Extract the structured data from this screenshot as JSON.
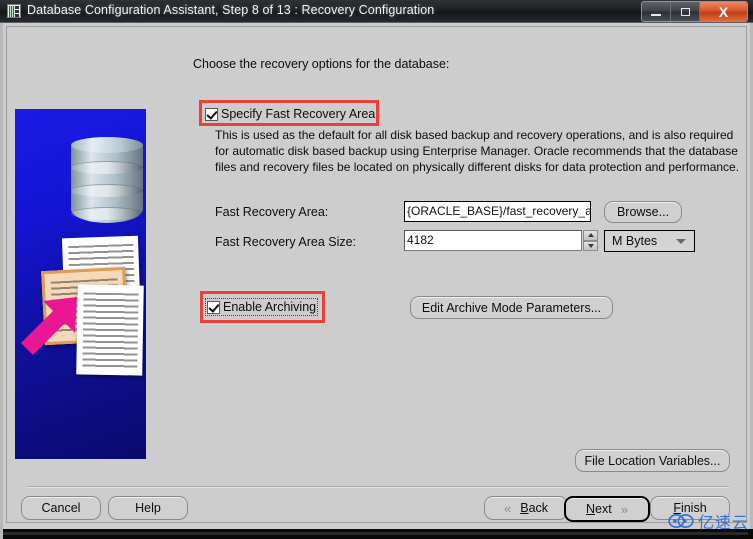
{
  "window": {
    "title": "Database Configuration Assistant, Step 8 of 13 : Recovery Configuration",
    "app_icon": "database-app-icon",
    "controls": {
      "minimize": "minimize-icon",
      "maximize": "maximize-icon",
      "close": "X"
    }
  },
  "main": {
    "heading": "Choose the recovery options for the database:",
    "specify_fra": {
      "label": "Specify Fast Recovery Area",
      "checked": true
    },
    "description": "This is used as the default for all disk based backup and recovery operations, and is also required for automatic disk based backup using Enterprise Manager. Oracle recommends that the database files and recovery files be located on physically different disks for data protection and performance.",
    "fields": [
      {
        "label": "Fast Recovery Area:",
        "value": "{ORACLE_BASE}/fast_recovery_a",
        "button": "Browse..."
      },
      {
        "label": "Fast Recovery Area Size:",
        "value": "4182",
        "unit": "M Bytes"
      }
    ],
    "enable_archiving": {
      "label": "Enable Archiving",
      "checked": true
    },
    "edit_archive_button": "Edit Archive Mode Parameters...",
    "file_location_button": "File Location Variables..."
  },
  "footer": {
    "cancel": "Cancel",
    "help": "Help",
    "back": "Back",
    "back_chevron": "«",
    "next": "Next",
    "next_chevron": "»",
    "finish": "Finish"
  },
  "watermark": {
    "text": "亿速云",
    "color": "#2f6fd0"
  },
  "colors": {
    "background": "#cdcdcd",
    "annotation": "#e8413c",
    "illustration_blue": "#1414d2",
    "arrow_magenta": "#ea1794"
  }
}
